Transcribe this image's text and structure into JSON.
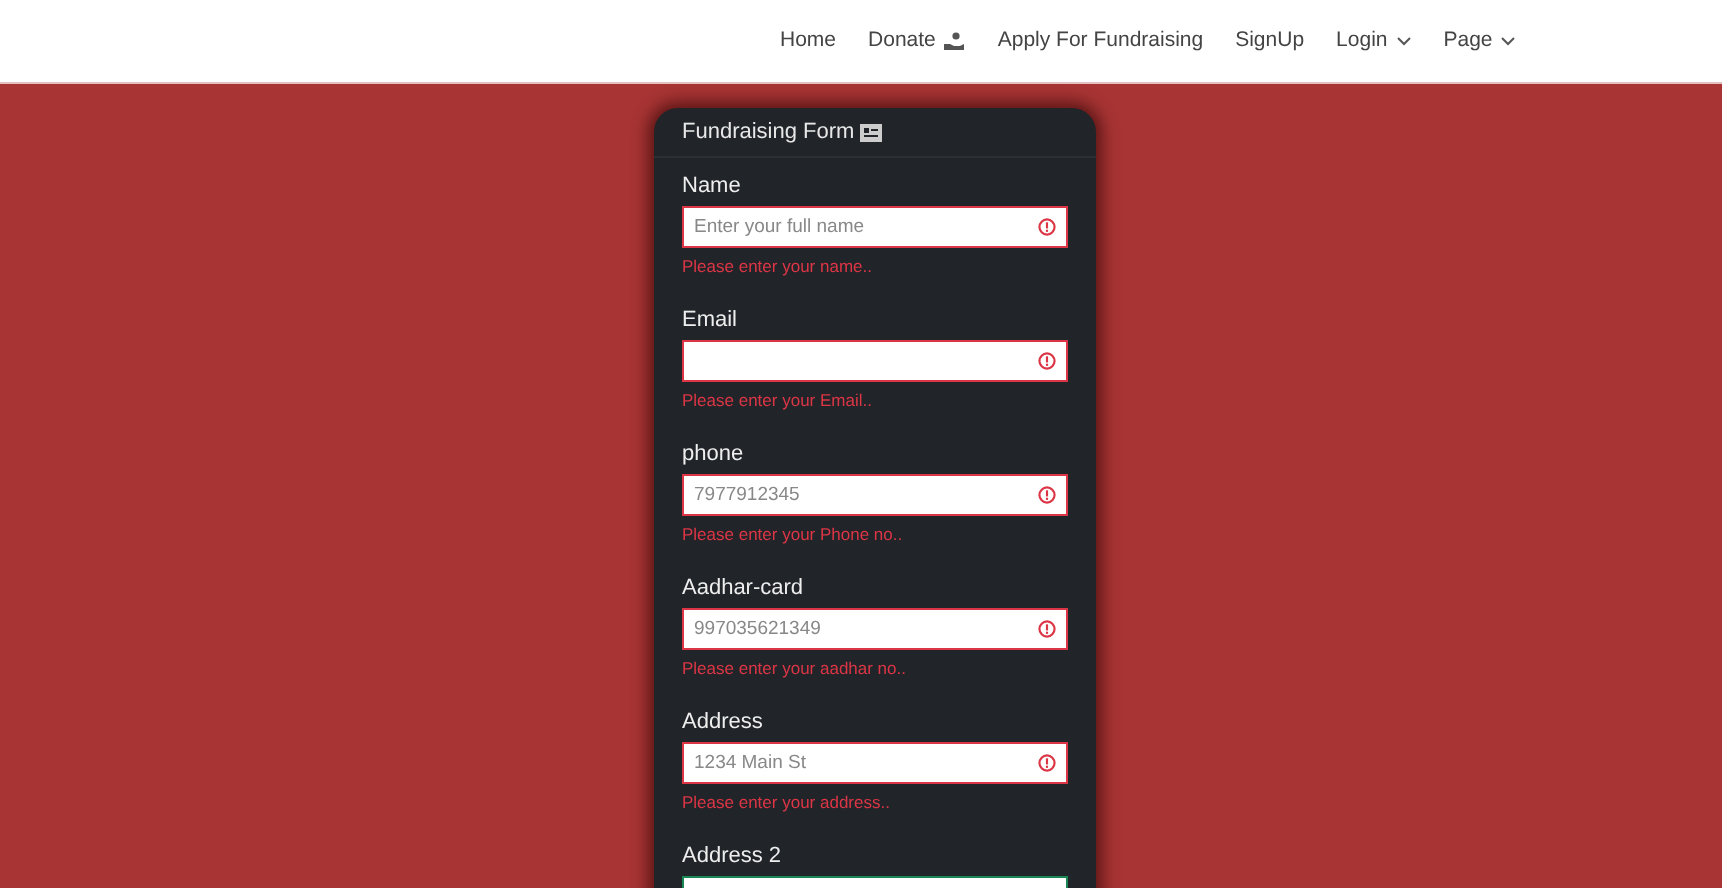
{
  "nav": [
    {
      "label": "Home",
      "kind": "link"
    },
    {
      "label": "Donate",
      "kind": "donate"
    },
    {
      "label": "Apply For Fundraising",
      "kind": "link"
    },
    {
      "label": "SignUp",
      "kind": "link"
    },
    {
      "label": "Login",
      "kind": "dropdown"
    },
    {
      "label": "Page",
      "kind": "dropdown"
    }
  ],
  "form": {
    "title": "Fundraising Form",
    "fields": [
      {
        "label": "Name",
        "placeholder": "Enter your full name",
        "valid": false,
        "error": "Please enter your name.."
      },
      {
        "label": "Email",
        "valid": false,
        "error": "Please enter your Email.."
      },
      {
        "label": "phone",
        "placeholder": "7977912345",
        "valid": false,
        "error": "Please enter your Phone no.."
      },
      {
        "label": "Aadhar-card",
        "placeholder": "997035621349",
        "valid": false,
        "error": "Please enter your aadhar no.."
      },
      {
        "label": "Address",
        "placeholder": "1234 Main St",
        "valid": false,
        "error": "Please enter your address.."
      },
      {
        "label": "Address 2",
        "valid": true
      }
    ]
  }
}
